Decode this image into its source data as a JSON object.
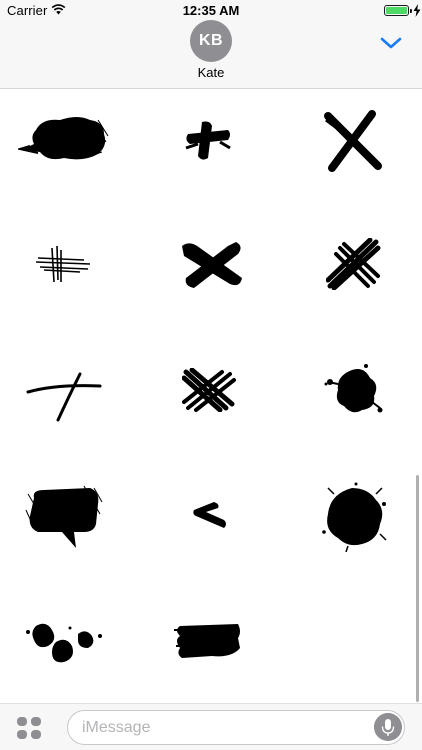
{
  "status_bar": {
    "carrier": "Carrier",
    "time": "12:35 AM",
    "battery_level": 1.0,
    "battery_color": "#4cd964"
  },
  "header": {
    "avatar_initials": "KB",
    "contact_name": "Kate",
    "avatar_color": "#8e8e93",
    "accent_color": "#1a7cf5",
    "collapse_icon": "chevron-down-icon"
  },
  "stickers": [
    {
      "name": "sticker-scribble-speech-bubble"
    },
    {
      "name": "sticker-small-brush-cross"
    },
    {
      "name": "sticker-bold-x"
    },
    {
      "name": "sticker-thin-hatch-cross"
    },
    {
      "name": "sticker-thick-brush-x"
    },
    {
      "name": "sticker-scratchy-x"
    },
    {
      "name": "sticker-hand-drawn-plus"
    },
    {
      "name": "sticker-multi-stroke-x"
    },
    {
      "name": "sticker-ink-splat-small"
    },
    {
      "name": "sticker-hatched-speech-bubble"
    },
    {
      "name": "sticker-brush-arrow"
    },
    {
      "name": "sticker-ink-splat-large"
    },
    {
      "name": "sticker-ink-drops"
    },
    {
      "name": "sticker-brush-stroke"
    }
  ],
  "message_bar": {
    "placeholder": "iMessage",
    "apps_icon": "app-drawer-icon",
    "mic_icon": "microphone-icon"
  }
}
